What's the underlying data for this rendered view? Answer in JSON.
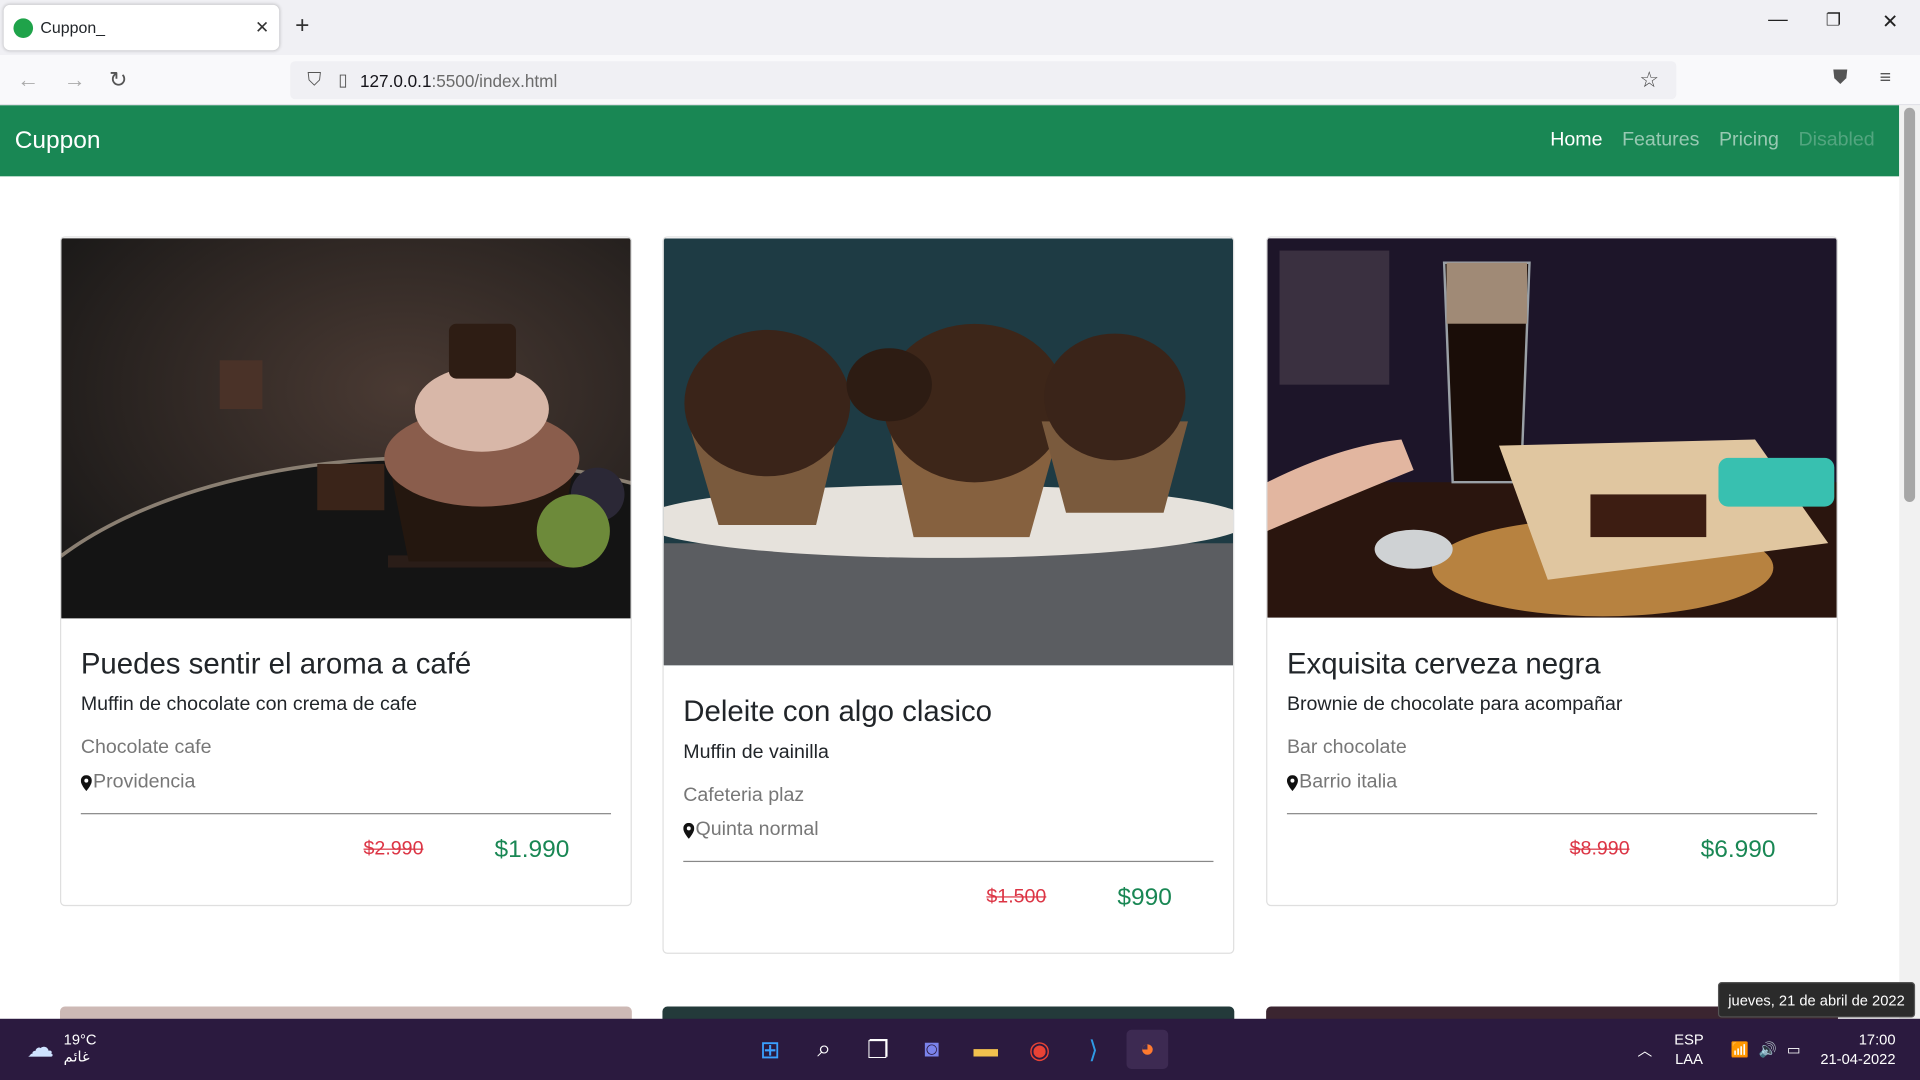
{
  "browser": {
    "tab_title": "Cuppon_",
    "url_host": "127.0.0.1",
    "url_path": ":5500/index.html"
  },
  "site": {
    "brand": "Cuppon",
    "nav": {
      "home": "Home",
      "features": "Features",
      "pricing": "Pricing",
      "disabled": "Disabled"
    },
    "colors": {
      "primary": "#198754",
      "old_price": "#dc3545"
    }
  },
  "cards": [
    {
      "title": "Puedes sentir el aroma a café",
      "subtitle": "Muffin de chocolate con crema de cafe",
      "place": "Chocolate cafe",
      "location": "Providencia",
      "old_price": "$2.990",
      "new_price": "$1.990"
    },
    {
      "title": "Deleite con algo clasico",
      "subtitle": "Muffin de vainilla",
      "place": "Cafeteria plaz",
      "location": "Quinta normal",
      "old_price": "$1.500",
      "new_price": "$990"
    },
    {
      "title": "Exquisita cerveza negra",
      "subtitle": "Brownie de chocolate para acompañar",
      "place": "Bar chocolate",
      "location": "Barrio italia",
      "old_price": "$8.990",
      "new_price": "$6.990"
    }
  ],
  "taskbar": {
    "temp": "19°C",
    "weather_text": "غائم",
    "lang1": "ESP",
    "lang2": "LAA",
    "time": "17:00",
    "date": "21-04-2022",
    "tooltip": "jueves, 21 de abril de 2022"
  }
}
